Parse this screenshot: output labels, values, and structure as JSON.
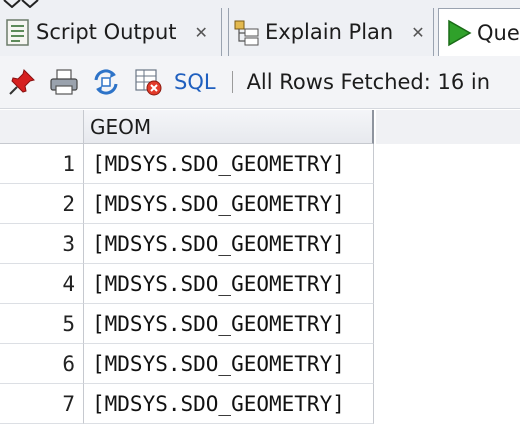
{
  "tabs": [
    {
      "label": "Script Output",
      "icon": "script-output-icon",
      "close": "✕"
    },
    {
      "label": "Explain Plan",
      "icon": "explain-plan-icon",
      "close": "✕"
    },
    {
      "label": "Que",
      "icon": "run-query-icon"
    }
  ],
  "toolbar": {
    "pin_icon": "pin-icon",
    "print_icon": "print-icon",
    "refresh_icon": "refresh-icon",
    "clear_icon": "clear-icon",
    "sql_label": "SQL",
    "separator": "|",
    "status": "All Rows Fetched: 16 in"
  },
  "grid": {
    "columns": [
      "GEOM"
    ],
    "rows": [
      {
        "num": "1",
        "geom": "[MDSYS.SDO_GEOMETRY]"
      },
      {
        "num": "2",
        "geom": "[MDSYS.SDO_GEOMETRY]"
      },
      {
        "num": "3",
        "geom": "[MDSYS.SDO_GEOMETRY]"
      },
      {
        "num": "4",
        "geom": "[MDSYS.SDO_GEOMETRY]"
      },
      {
        "num": "5",
        "geom": "[MDSYS.SDO_GEOMETRY]"
      },
      {
        "num": "6",
        "geom": "[MDSYS.SDO_GEOMETRY]"
      },
      {
        "num": "7",
        "geom": "[MDSYS.SDO_GEOMETRY]"
      }
    ]
  },
  "colors": {
    "link": "#1f5fbf",
    "run_green": "#2fa12a",
    "pin_red": "#d62020"
  }
}
